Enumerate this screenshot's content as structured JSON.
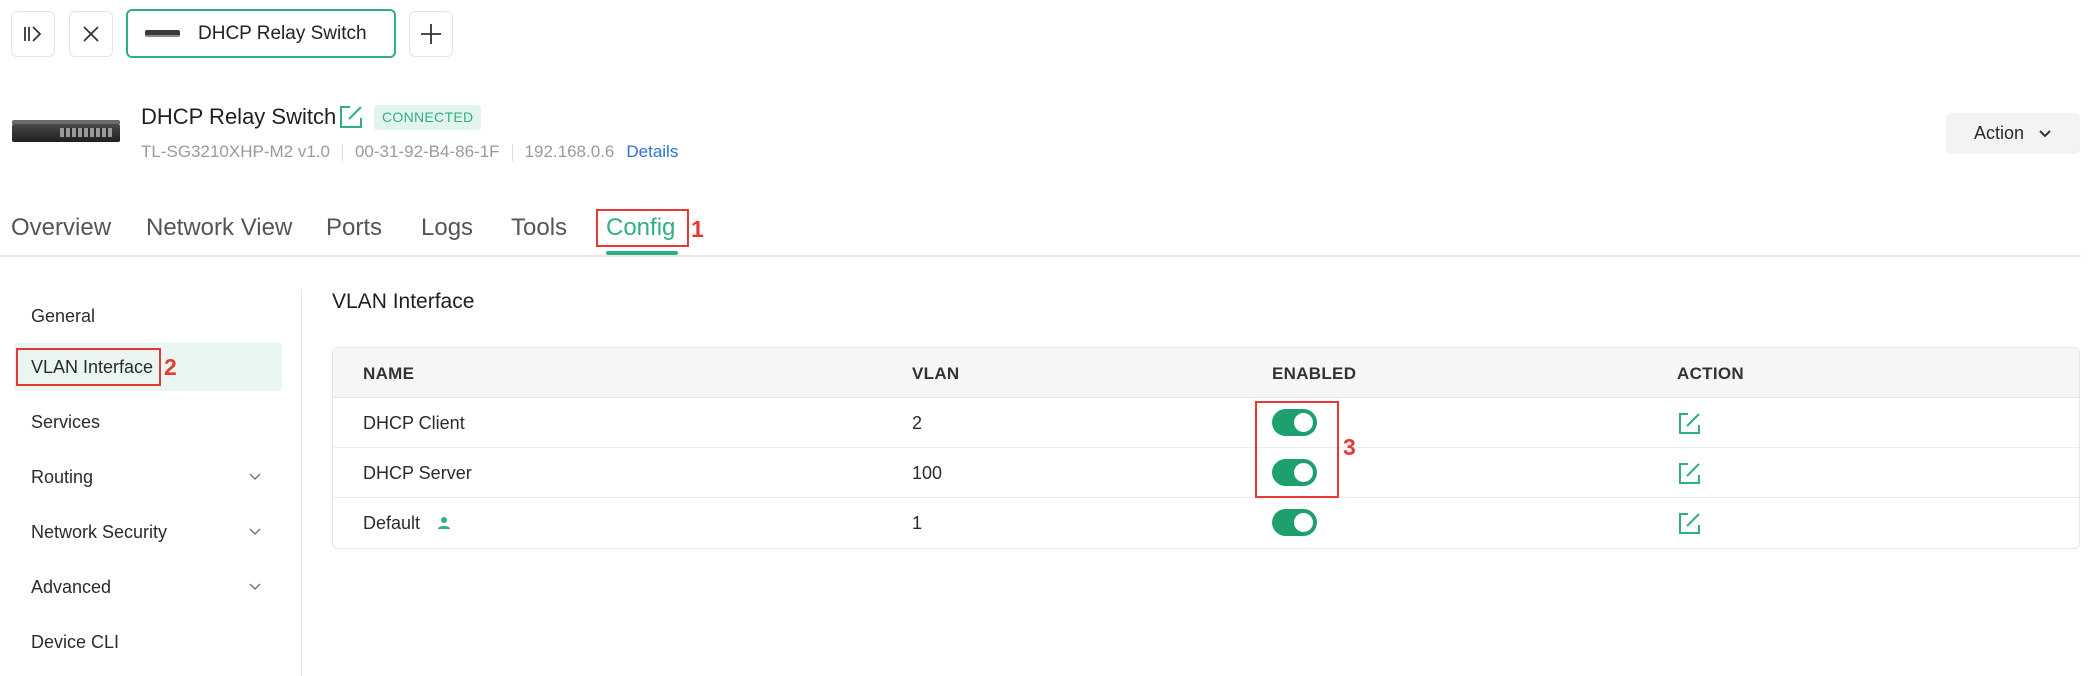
{
  "topbar": {
    "sidebar_toggle_icon": "sidebar-toggle-icon",
    "close_icon": "close-icon",
    "device_tab_label": "DHCP Relay Switch",
    "add_icon": "plus-icon"
  },
  "device": {
    "name": "DHCP Relay Switch",
    "status": "CONNECTED",
    "model": "TL-SG3210XHP-M2 v1.0",
    "mac": "00-31-92-B4-86-1F",
    "ip": "192.168.0.6",
    "details_link": "Details",
    "action_label": "Action"
  },
  "tabs": [
    {
      "label": "Overview",
      "active": false
    },
    {
      "label": "Network View",
      "active": false
    },
    {
      "label": "Ports",
      "active": false
    },
    {
      "label": "Logs",
      "active": false
    },
    {
      "label": "Tools",
      "active": false
    },
    {
      "label": "Config",
      "active": true
    }
  ],
  "side_menu": [
    {
      "label": "General",
      "active": false,
      "expandable": false
    },
    {
      "label": "VLAN Interface",
      "active": true,
      "expandable": false
    },
    {
      "label": "Services",
      "active": false,
      "expandable": false
    },
    {
      "label": "Routing",
      "active": false,
      "expandable": true
    },
    {
      "label": "Network Security",
      "active": false,
      "expandable": true
    },
    {
      "label": "Advanced",
      "active": false,
      "expandable": true
    },
    {
      "label": "Device CLI",
      "active": false,
      "expandable": false
    }
  ],
  "content": {
    "title": "VLAN Interface",
    "columns": [
      "NAME",
      "VLAN",
      "ENABLED",
      "ACTION"
    ],
    "rows": [
      {
        "name": "DHCP Client",
        "vlan": "2",
        "enabled": true
      },
      {
        "name": "DHCP Server",
        "vlan": "100",
        "enabled": true
      },
      {
        "name": "Default",
        "vlan": "1",
        "enabled": true
      }
    ]
  },
  "annotations": {
    "step1": "1",
    "step2": "2",
    "step3": "3"
  },
  "colors": {
    "accent": "#2fb081",
    "toggle_on": "#1e9f6e",
    "annotation_red": "#e53935",
    "link_blue": "#2a74d6"
  }
}
